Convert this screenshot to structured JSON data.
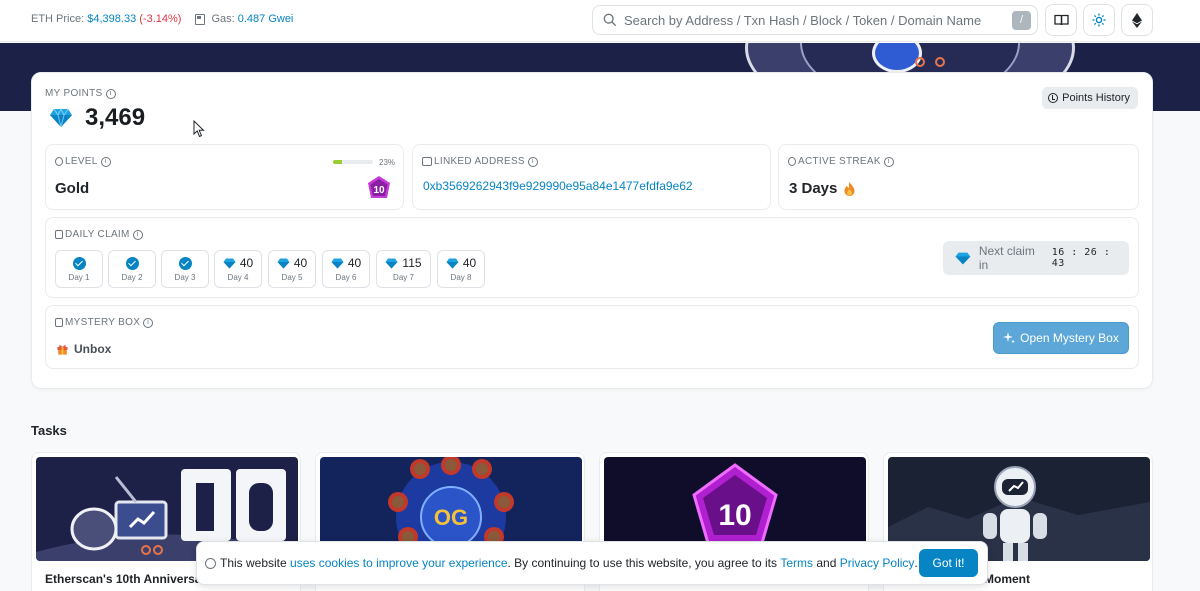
{
  "topbar": {
    "eth_price_label": "ETH Price:",
    "eth_price_value": "$4,398.33",
    "eth_price_change": "(-3.14%)",
    "gas_label": "Gas:",
    "gas_value": "0.487 Gwei",
    "search_placeholder": "Search by Address / Txn Hash / Block / Token / Domain Name",
    "search_shortcut": "/"
  },
  "points": {
    "label": "MY POINTS",
    "value": "3,469",
    "history_button": "Points History"
  },
  "level": {
    "label": "LEVEL",
    "value": "Gold",
    "progress_text": "23%",
    "progress_fraction": 0.23,
    "badge_number": "10"
  },
  "linked_address": {
    "label": "LINKED ADDRESS",
    "value": "0xb3569262943f9e929990e95a84e1477efdfa9e62"
  },
  "streak": {
    "label": "ACTIVE STREAK",
    "value": "3 Days"
  },
  "daily_claim": {
    "label": "DAILY CLAIM",
    "days": [
      {
        "label": "Day 1",
        "claimed": true
      },
      {
        "label": "Day 2",
        "claimed": true
      },
      {
        "label": "Day 3",
        "claimed": true
      },
      {
        "label": "Day 4",
        "amount": "40"
      },
      {
        "label": "Day 5",
        "amount": "40"
      },
      {
        "label": "Day 6",
        "amount": "40"
      },
      {
        "label": "Day 7",
        "amount": "115"
      },
      {
        "label": "Day 8",
        "amount": "40"
      }
    ],
    "next_claim_label": "Next claim in",
    "timer": "16 : 26 : 43"
  },
  "mystery_box": {
    "label": "MYSTERY BOX",
    "unbox_label": "Unbox",
    "open_button": "Open Mystery Box"
  },
  "tasks": {
    "title": "Tasks",
    "items": [
      {
        "title": "Etherscan's 10th Anniversa",
        "image": "anniversary-robot-10-image"
      },
      {
        "title": "",
        "image": "og-astronauts-image"
      },
      {
        "title": "",
        "image": "pentagon-10-image"
      },
      {
        "title": "Moment",
        "image": "astronaut-robot-image"
      }
    ]
  },
  "cookie": {
    "text_1": "This website",
    "link_1": "uses cookies to improve your experience",
    "text_2": ". By continuing to use this website, you agree to its",
    "link_2": "Terms",
    "text_3": "and",
    "link_3": "Privacy Policy",
    "text_4": ".",
    "button": "Got it!"
  },
  "colors": {
    "accent": "#0784c3",
    "negative": "#dc3545",
    "banner": "#1c2147",
    "mystery_button": "#5ca7d8"
  }
}
